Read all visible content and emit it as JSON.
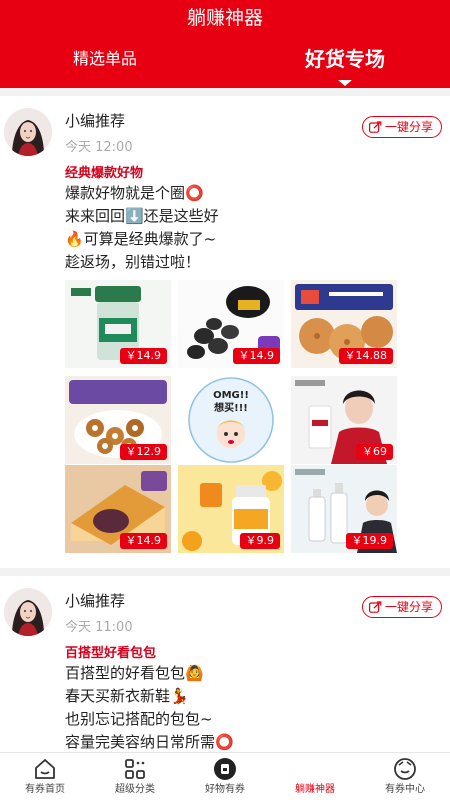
{
  "header": {
    "title": "躺赚神器",
    "tabs": [
      {
        "label": "精选单品",
        "active": false
      },
      {
        "label": "好货专场",
        "active": true
      }
    ]
  },
  "posts": [
    {
      "author": "小编推荐",
      "time": "今天 12:00",
      "share_label": "一键分享",
      "title": "经典爆款好物",
      "lines": [
        "爆款好物就是个圈⭕",
        "来来回回⬇️还是这些好",
        "🔥可算是经典爆款了~",
        "趁返场，别错过啦！"
      ],
      "products": [
        {
          "price": "￥14.9",
          "icon": "powder-jar"
        },
        {
          "price": "￥14.9",
          "icon": "black-fruit"
        },
        {
          "price": "￥14.88",
          "icon": "biscuits"
        },
        {
          "price": "￥12.9",
          "icon": "donut-cookies"
        },
        {
          "price": "",
          "icon": "omg-sticker",
          "sticker_text": [
            "OMG!!",
            "想买!!!"
          ]
        },
        {
          "price": "￥69",
          "icon": "model-skincare"
        },
        {
          "price": "￥14.9",
          "icon": "cake-slice"
        },
        {
          "price": "￥9.9",
          "icon": "vitamin-bottle"
        },
        {
          "price": "￥19.9",
          "icon": "serum-bottles"
        }
      ]
    },
    {
      "author": "小编推荐",
      "time": "今天 11:00",
      "share_label": "一键分享",
      "title": "百搭型好看包包",
      "lines": [
        "百搭型的好看包包🙆",
        "春天买新衣新鞋💃",
        "也别忘记搭配的包包~",
        "容量完美容纳日常所需⭕"
      ]
    }
  ],
  "bottom_nav": [
    {
      "label": "有券首页",
      "icon": "home-icon",
      "active": false
    },
    {
      "label": "超级分类",
      "icon": "category-icon",
      "active": false
    },
    {
      "label": "好物有券",
      "icon": "coupon-icon",
      "active": false
    },
    {
      "label": "躺赚神器",
      "icon": "earn-icon",
      "active": true
    },
    {
      "label": "有券中心",
      "icon": "profile-icon",
      "active": false
    }
  ],
  "colors": {
    "brand": "#e60012",
    "title_red": "#d6001c",
    "muted": "#aaaaaa"
  }
}
